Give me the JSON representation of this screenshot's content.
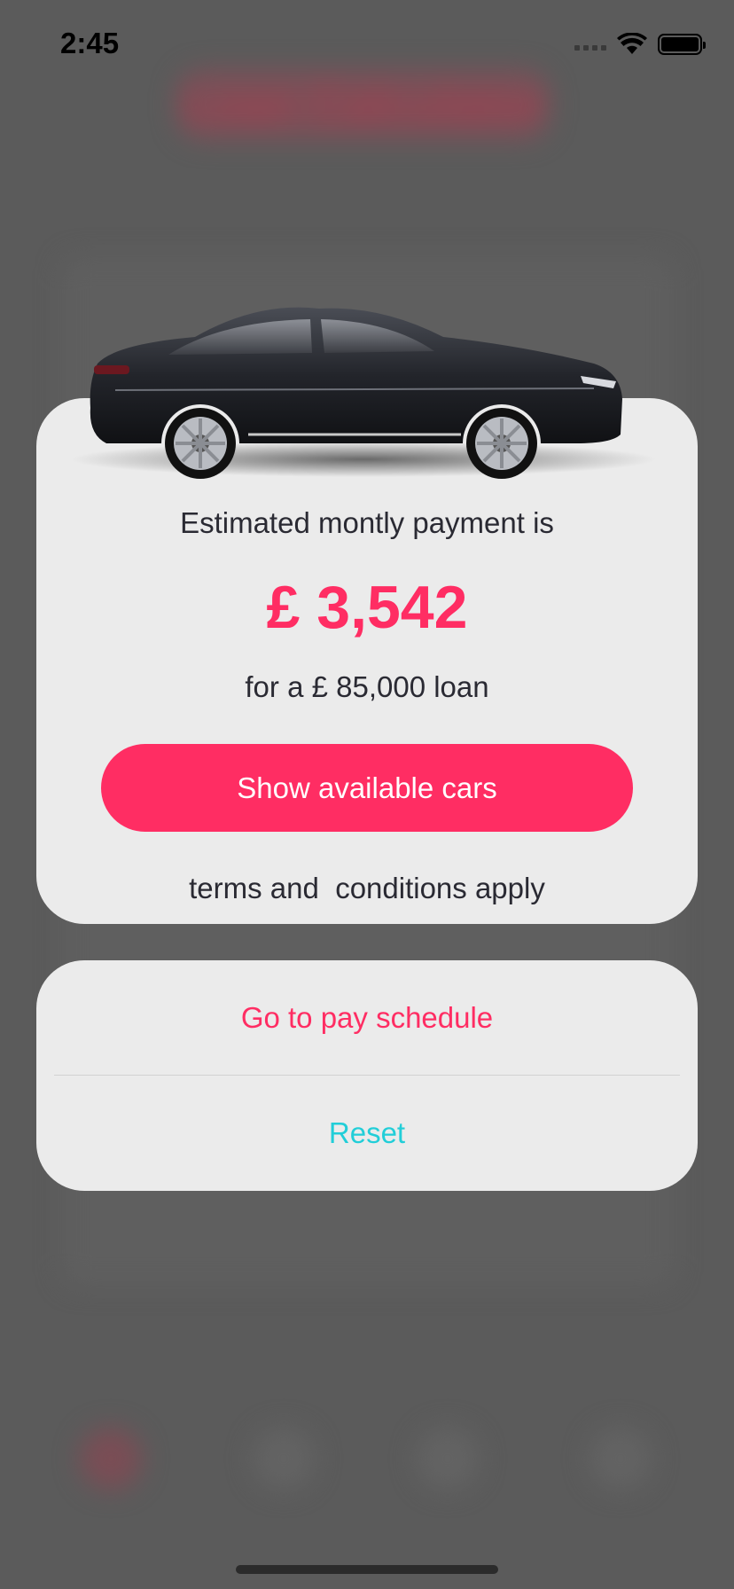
{
  "status_bar": {
    "time": "2:45",
    "icons": [
      "cellular-signal-icon",
      "wifi-icon",
      "battery-icon"
    ]
  },
  "background": {
    "title": "Loan Calculator",
    "tabs": [
      "calculator-tab-icon",
      "calendar-tab-icon",
      "history-tab-icon",
      "grid-tab-icon"
    ]
  },
  "result_sheet": {
    "image": "car-image",
    "estimated_label": "Estimated montly payment is",
    "payment_amount": "£ 3,542",
    "loan_label": "for a £ 85,000 loan",
    "show_cars_button": "Show available cars",
    "terms": "terms and  conditions apply"
  },
  "action_sheet": {
    "pay_schedule": "Go to pay schedule",
    "reset": "Reset"
  },
  "colors": {
    "accent": "#ff2d63",
    "reset": "#22ced8",
    "sheet": "#ebebeb",
    "overlay": "#5b5b5b"
  }
}
